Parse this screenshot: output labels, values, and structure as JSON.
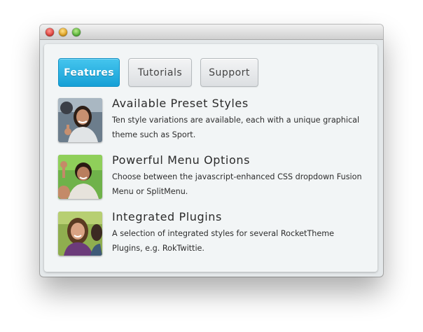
{
  "tabs": [
    {
      "label": "Features",
      "active": true
    },
    {
      "label": "Tutorials",
      "active": false
    },
    {
      "label": "Support",
      "active": false
    }
  ],
  "items": [
    {
      "title": "Available Preset Styles",
      "description": "Ten style variations are available, each with a unique graphical theme such as Sport."
    },
    {
      "title": "Powerful Menu Options",
      "description": "Choose between the javascript-enhanced CSS dropdown Fusion Menu or SplitMenu."
    },
    {
      "title": "Integrated Plugins",
      "description": "A selection of integrated styles for several RocketTheme Plugins, e.g. RokTwittie."
    }
  ],
  "colors": {
    "accent": "#16a0d6",
    "panel_background": "#f2f5f6",
    "window_background": "#e4e8ea"
  },
  "icons": {
    "traffic_lights": [
      "close-icon",
      "minimize-icon",
      "zoom-icon"
    ]
  }
}
